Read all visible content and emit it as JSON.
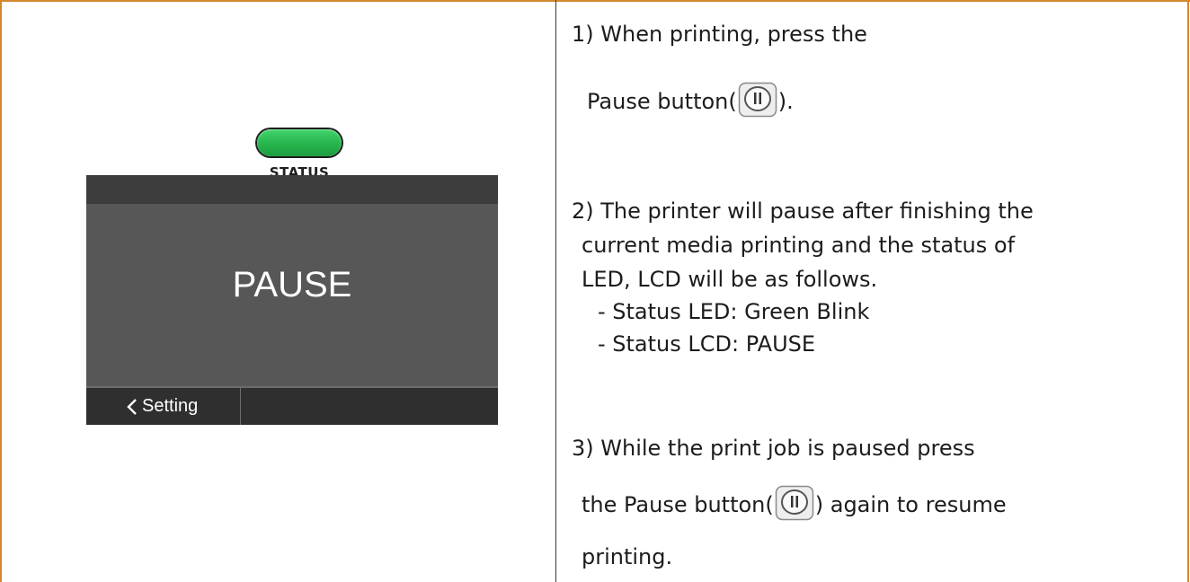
{
  "led": {
    "label": "STATUS",
    "color": "#2db552"
  },
  "lcd": {
    "message": "PAUSE",
    "bottom_button": "Setting"
  },
  "steps": {
    "s1_line1": "1) When printing, press the",
    "s1_line2a": "Pause button(",
    "s1_line2b": ").",
    "s2_line1": "2) The printer will pause after finishing the",
    "s2_line2": "current media printing and the status of",
    "s2_line3": "LED, LCD will be as follows.",
    "s2_line4": "- Status LED: Green Blink",
    "s2_line5": "- Status LCD: PAUSE",
    "s3_line1": "3) While the print job is paused press",
    "s3_line2a": "the Pause button(",
    "s3_line2b": ") again to resume",
    "s3_line3": "printing."
  },
  "icons": {
    "pause": "pause-button-icon",
    "back": "chevron-left-icon"
  },
  "colors": {
    "frame": "#d4882e",
    "lcd_body": "#575757",
    "lcd_bar": "#3d3d3d"
  }
}
